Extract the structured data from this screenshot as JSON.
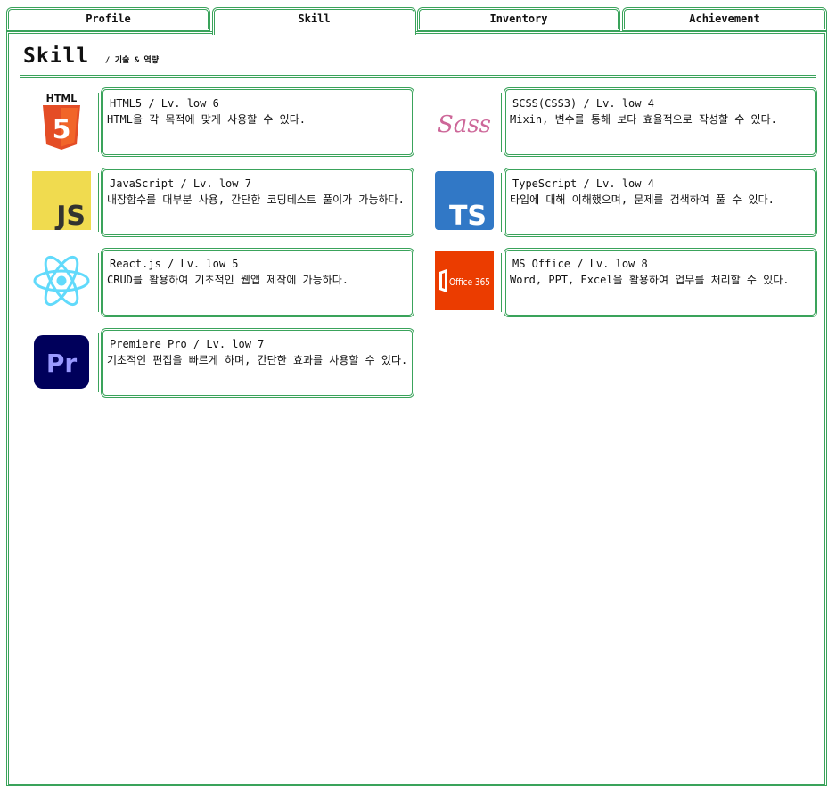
{
  "tabs": [
    {
      "label": "Profile"
    },
    {
      "label": "Skill"
    },
    {
      "label": "Inventory"
    },
    {
      "label": "Achievement"
    }
  ],
  "active_tab": "Skill",
  "colors": {
    "accent": "#3aa35b"
  },
  "page": {
    "title": "Skill",
    "subtitle": "/ 기술 & 역량"
  },
  "skills": [
    {
      "name": "HTML5 / Lv. low 6",
      "desc": "HTML을 각 목적에 맞게 사용할 수 있다.",
      "logo": "html5-logo",
      "logo_text": "5",
      "logo_label": "HTML"
    },
    {
      "name": "SCSS(CSS3) / Lv. low 4",
      "desc": "Mixin, 변수를 통해 보다 효율적으로 작성할 수 있다.",
      "logo": "sass-logo",
      "logo_text": "Sass"
    },
    {
      "name": "JavaScript / Lv. low 7",
      "desc": "내장함수를 대부분 사용, 간단한 코딩테스트 풀이가 가능하다.",
      "logo": "javascript-logo",
      "logo_text": "JS"
    },
    {
      "name": "TypeScript / Lv. low 4",
      "desc": "타입에 대해 이해했으며, 문제를 검색하여 풀 수 있다.",
      "logo": "typescript-logo",
      "logo_text": "TS"
    },
    {
      "name": "React.js / Lv. low 5",
      "desc": "CRUD를 활용하여 기초적인 웹앱 제작에 가능하다.",
      "logo": "react-logo"
    },
    {
      "name": "MS Office / Lv. low 8",
      "desc": "Word, PPT, Excel을 활용하여 업무를 처리할 수 있다.",
      "logo": "office365-logo",
      "logo_text": "Office 365"
    },
    {
      "name": "Premiere Pro / Lv. low 7",
      "desc": "기초적인 편집을 빠르게 하며, 간단한 효과를 사용할 수 있다.",
      "logo": "premiere-pro-logo",
      "logo_text": "Pr"
    }
  ]
}
